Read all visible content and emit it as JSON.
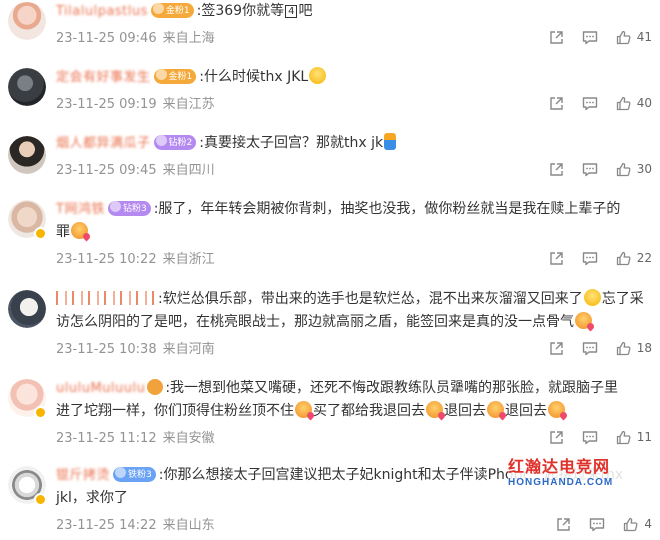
{
  "comments": [
    {
      "username": "Tilalulpastlus",
      "badge": "金粉1",
      "text_a": ":签369你就等",
      "boxed": "4",
      "text_b": "吧",
      "time": "23-11-25 09:46",
      "location": "来自上海",
      "likes": "41"
    },
    {
      "username": "定会有好事发生",
      "badge": "金粉1",
      "text_a": ":什么时候thx JKL",
      "time": "23-11-25 09:19",
      "location": "来自江苏",
      "likes": "40"
    },
    {
      "username": "烟人都异满瓜子",
      "badge": "钻粉2",
      "text_a": ":真要接太子回宫？那就thx jk",
      "time": "23-11-25 09:45",
      "location": "来自四川",
      "likes": "30"
    },
    {
      "username": "T网鸿铁",
      "badge": "钻粉3",
      "text_a": ":服了，年年转会期被你背刺，抽奖也没我，做你粉丝就当是我在赎上辈子的",
      "text_b": "罪",
      "time": "23-11-25 10:22",
      "location": "来自浙江",
      "likes": "22"
    },
    {
      "username": "",
      "text_a": ":软烂怂俱乐部，带出来的选手也是软烂怂，混不出来灰溜溜又回来了",
      "text_b": "忘了采",
      "text_c": "访怎么阴阳的了是吧，在桃亮眼战士，那边就高丽之盾，能签回来是真的没一点骨气",
      "time": "23-11-25 10:38",
      "location": "来自河南",
      "likes": "18"
    },
    {
      "username": "ululuMuluulu",
      "text_a": ":我一想到他菜又嘴硬，还死不悔改跟教练队员犟嘴的那张脸，就跟脑子里",
      "text_b": "进了坨翔一样，你们顶得住粉丝顶不住",
      "text_c": "买了都给我退回去",
      "text_d": "退回去",
      "text_e": "退回去",
      "time": "23-11-25 11:12",
      "location": "来自安徽",
      "likes": "11"
    },
    {
      "username": "锟斤拷烫",
      "badge": "铁粉3",
      "text_a": ":你那么想接太子回宫建议把太子妃knight和太子伴读Photic一起接过来thx",
      "text_b": "jkl，求你了",
      "time": "23-11-25 14:22",
      "location": "来自山东",
      "likes": "4"
    }
  ],
  "watermark": {
    "title": "红瀚达电竞网",
    "url": "HONGHANDA.COM"
  },
  "icons": {
    "share": "share-icon",
    "comment": "comment-icon",
    "like": "thumbs-up-icon"
  },
  "colors": {
    "username": "#eb7350",
    "meta": "#939393",
    "watermark_red": "#e0322b",
    "watermark_blue": "#2d6ac8"
  }
}
